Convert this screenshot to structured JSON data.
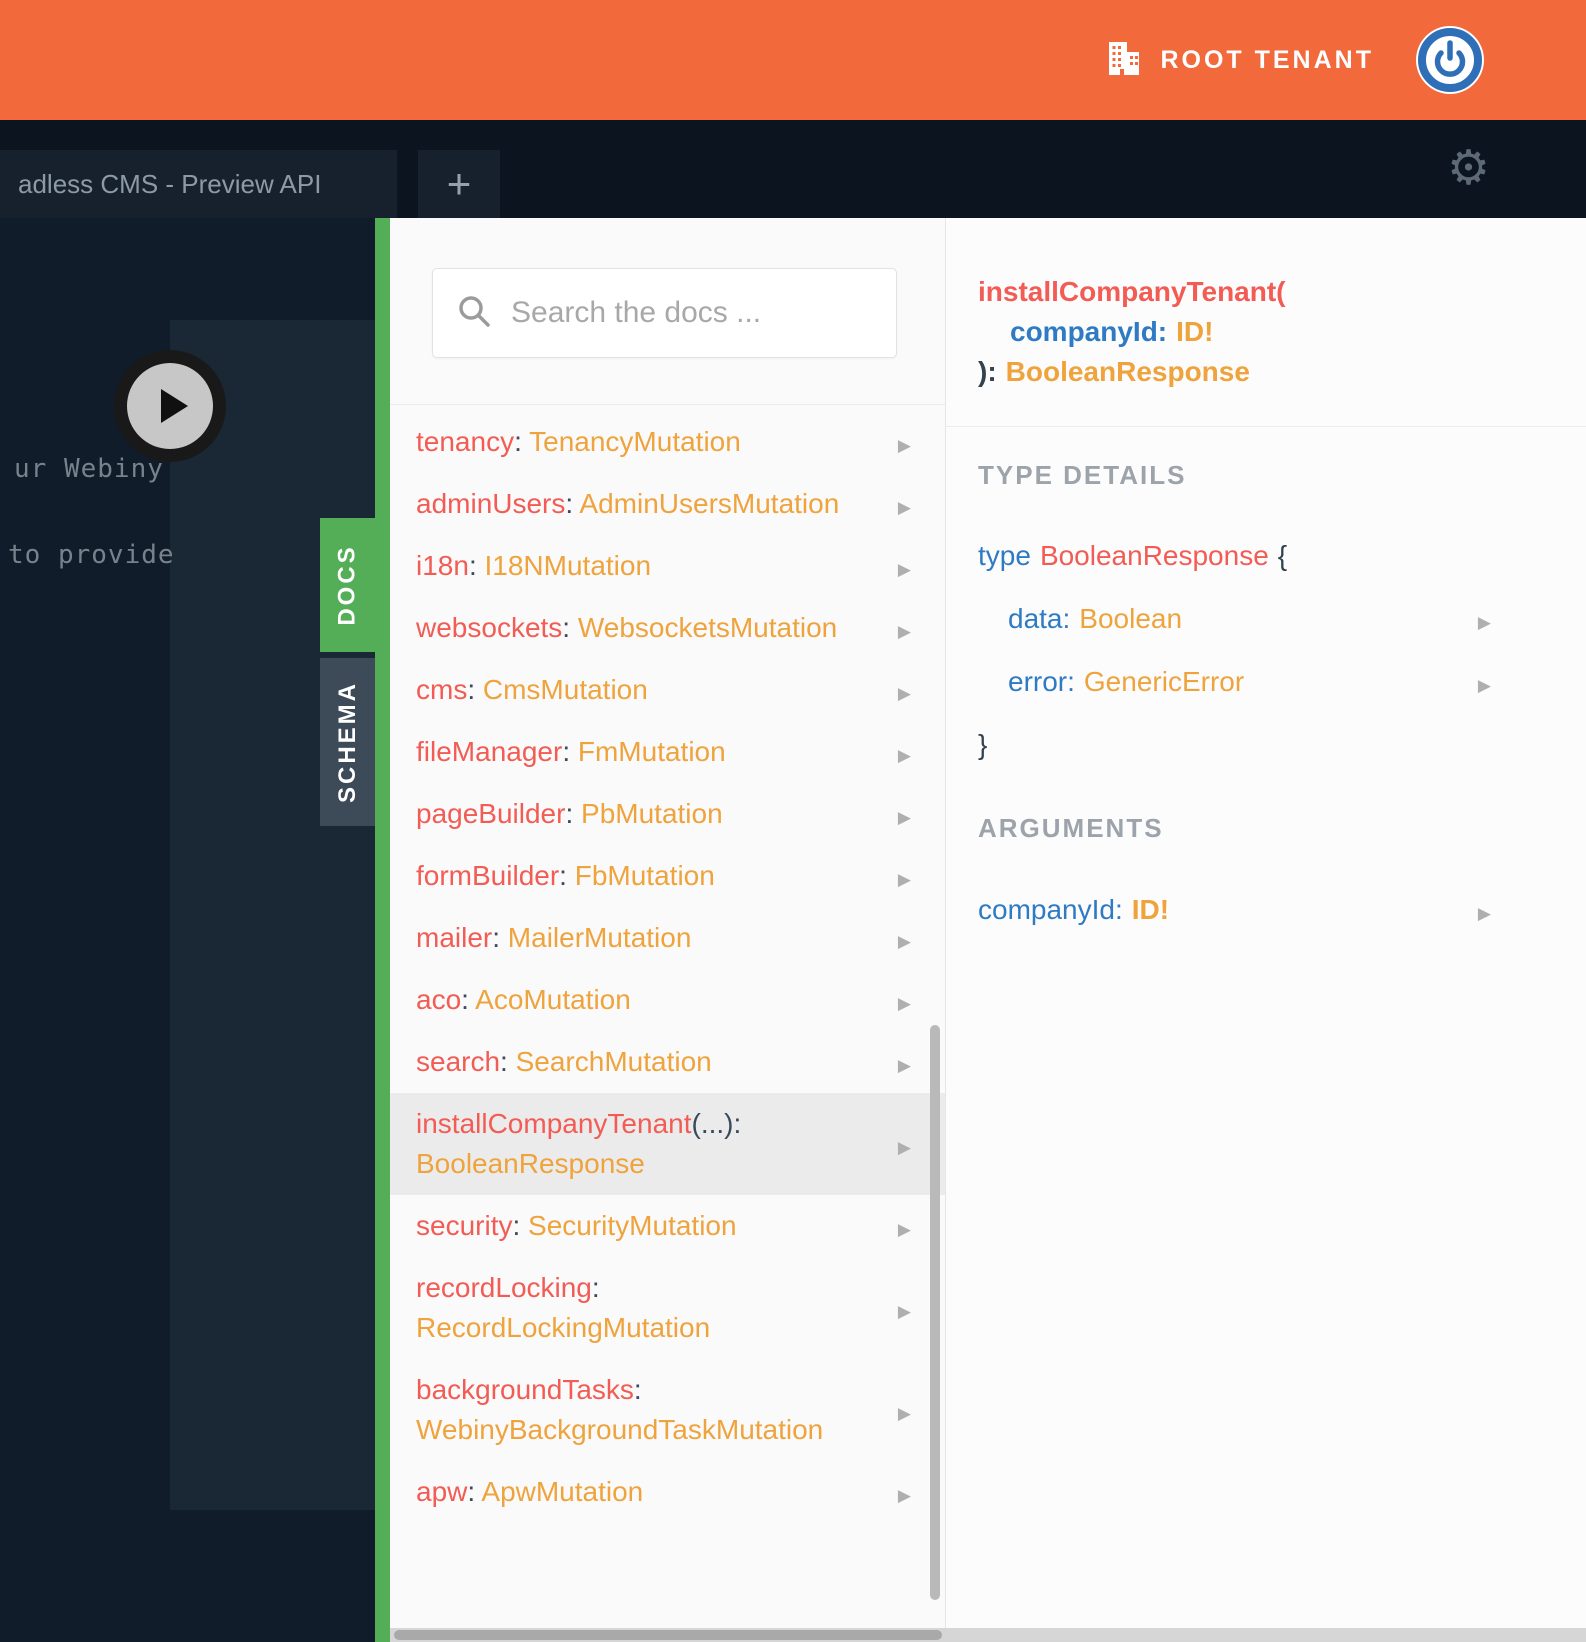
{
  "topbar": {
    "tenant_label": "ROOT TENANT"
  },
  "tabbar": {
    "tab_title": "adless CMS - Preview API",
    "new_tab_label": "+"
  },
  "editor": {
    "code_line_1": "ur Webiny",
    "code_line_2": "to provide"
  },
  "side_tabs": {
    "docs": "DOCS",
    "schema": "SCHEMA"
  },
  "colors": {
    "accent_orange": "#F2693C",
    "accent_green": "#54AE58",
    "field_red": "#F25C54",
    "type_orange": "#EFA33D",
    "arg_blue": "#2F7BC3"
  },
  "docs": {
    "search_placeholder": "Search the docs ...",
    "items": [
      {
        "field": "tenancy",
        "punct": ": ",
        "type": "TenancyMutation"
      },
      {
        "field": "adminUsers",
        "punct": ": ",
        "type": "AdminUsersMutation"
      },
      {
        "field": "i18n",
        "punct": ": ",
        "type": "I18NMutation"
      },
      {
        "field": "websockets",
        "punct": ": ",
        "type": "WebsocketsMutation"
      },
      {
        "field": "cms",
        "punct": ": ",
        "type": "CmsMutation"
      },
      {
        "field": "fileManager",
        "punct": ": ",
        "type": "FmMutation"
      },
      {
        "field": "pageBuilder",
        "punct": ": ",
        "type": "PbMutation"
      },
      {
        "field": "formBuilder",
        "punct": ": ",
        "type": "FbMutation"
      },
      {
        "field": "mailer",
        "punct": ": ",
        "type": "MailerMutation"
      },
      {
        "field": "aco",
        "punct": ": ",
        "type": "AcoMutation"
      },
      {
        "field": "search",
        "punct": ": ",
        "type": "SearchMutation"
      },
      {
        "field": "installCompanyTenant",
        "punct": "(...): ",
        "type": "BooleanResponse",
        "selected": true
      },
      {
        "field": "security",
        "punct": ": ",
        "type": "SecurityMutation"
      },
      {
        "field": "recordLocking",
        "punct": ": ",
        "type": "RecordLockingMutation"
      },
      {
        "field": "backgroundTasks",
        "punct": ": ",
        "type": "WebinyBackgroundTaskMutation"
      },
      {
        "field": "apw",
        "punct": ": ",
        "type": "ApwMutation"
      }
    ]
  },
  "detail": {
    "signature": {
      "name": "installCompanyTenant(",
      "arg_name": "companyId:",
      "arg_type": "ID!",
      "close": "):",
      "return_type": "BooleanResponse"
    },
    "type_details": {
      "heading": "TYPE DETAILS",
      "keyword": "type",
      "type_name": "BooleanResponse",
      "open_brace": "{",
      "fields": [
        {
          "name": "data:",
          "type": "Boolean"
        },
        {
          "name": "error:",
          "type": "GenericError"
        }
      ],
      "close_brace": "}"
    },
    "arguments": {
      "heading": "ARGUMENTS",
      "items": [
        {
          "name": "companyId:",
          "type": "ID!"
        }
      ]
    }
  }
}
